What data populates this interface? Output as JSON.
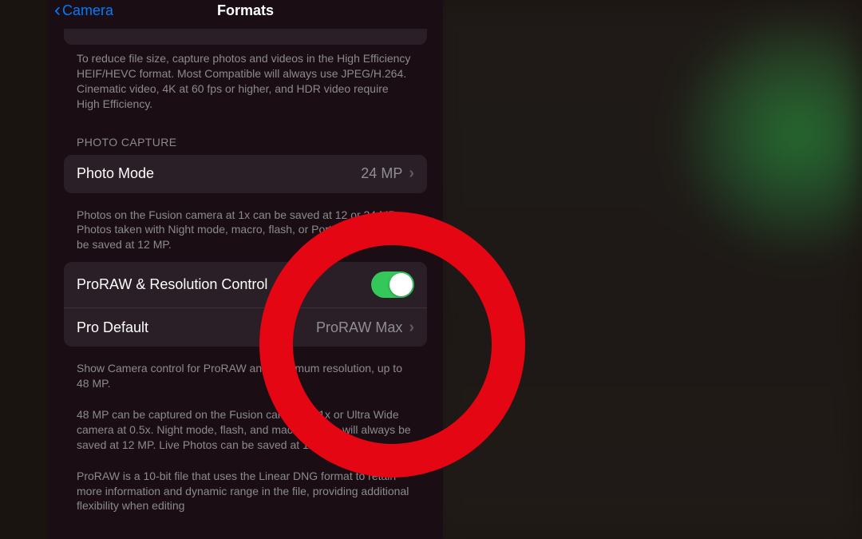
{
  "nav": {
    "back_label": "Camera",
    "title": "Formats"
  },
  "camera_capture_footer": "To reduce file size, capture photos and videos in the High Efficiency HEIF/HEVC format. Most Compatible will always use JPEG/H.264. Cinematic video, 4K at 60 fps or higher, and HDR video require High Efficiency.",
  "photo_capture": {
    "header": "PHOTO CAPTURE",
    "photo_mode": {
      "label": "Photo Mode",
      "value": "24 MP"
    },
    "photo_mode_footer": "Photos on the Fusion camera at 1x can be saved at 12 or 24 MP. Photos taken with Night mode, macro, flash, or Portrait Lighting will be saved at 12 MP.",
    "proraw_control": {
      "label": "ProRAW & Resolution Control",
      "enabled": true
    },
    "pro_default": {
      "label": "Pro Default",
      "value": "ProRAW Max"
    },
    "proraw_footer1": "Show Camera control for ProRAW and maximum resolution, up to 48 MP.",
    "proraw_footer2": "48 MP can be captured on the Fusion camera at 1x or Ultra Wide camera at 0.5x. Night mode, flash, and macro photos will always be saved at 12 MP. Live Photos can be saved at 12 or 24 MP.",
    "proraw_footer3": "ProRAW is a 10-bit file that uses the Linear DNG format to retain more information and dynamic range in the file, providing additional flexibility when editing"
  }
}
